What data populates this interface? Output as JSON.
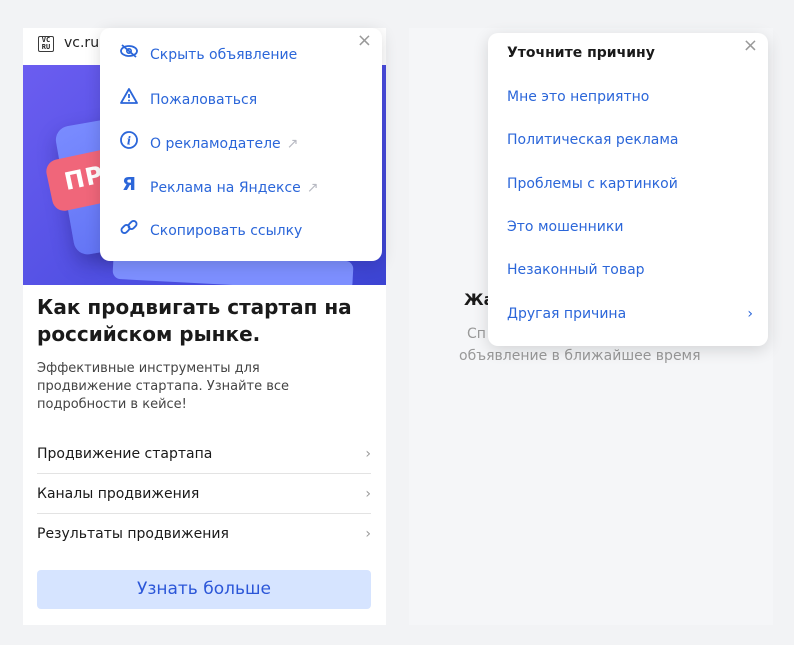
{
  "ad": {
    "logo_text": "VC\nRU",
    "domain": "vc.ru",
    "banner_text": "ПР",
    "title": "Как продвигать стартап на российском рынке.",
    "description": "Эффективные инструменты для продвижение стартапа. Узнайте все подробности в кейсе!",
    "links": [
      {
        "label": "Продвижение стартапа"
      },
      {
        "label": "Каналы продвижения"
      },
      {
        "label": "Результаты продвижения"
      }
    ],
    "cta_label": "Узнать больше"
  },
  "menu": {
    "close_glyph": "×",
    "items": [
      {
        "label": "Скрыть объявление",
        "icon": "eye-crossed-icon"
      },
      {
        "label": "Пожаловаться",
        "icon": "warning-icon"
      },
      {
        "label": "О рекламодателе",
        "icon": "info-icon",
        "external": true
      },
      {
        "label": "Реклама на Яндексе",
        "icon": "yandex-logo-icon",
        "external": true
      },
      {
        "label": "Скопировать ссылку",
        "icon": "link-icon"
      }
    ]
  },
  "right": {
    "partial_title": "Жа",
    "partial_line1": "Сп",
    "partial_line2": "объявление в ближайшее время"
  },
  "reason": {
    "title": "Уточните причину",
    "close_glyph": "×",
    "items": [
      {
        "label": "Мне это неприятно"
      },
      {
        "label": "Политическая реклама"
      },
      {
        "label": "Проблемы с картинкой"
      },
      {
        "label": "Это мошенники"
      },
      {
        "label": "Незаконный товар"
      },
      {
        "label": "Другая причина",
        "has_submenu": true
      }
    ]
  },
  "colors": {
    "link_blue": "#2b66d9",
    "cta_bg": "#d6e4ff",
    "banner_purple": "#5a54e8",
    "pill_red": "#f0667a",
    "page_bg": "#f2f3f5"
  }
}
